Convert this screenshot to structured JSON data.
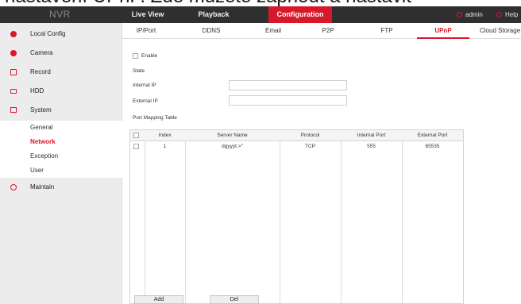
{
  "caption": {
    "text": "nastavení UPnP. Zde můžete zapnout a nastavit"
  },
  "topbar": {
    "brand": "NVR",
    "tabs": [
      {
        "label": "Live View"
      },
      {
        "label": "Playback"
      },
      {
        "label": "Configuration",
        "active": true
      }
    ],
    "user_label": "admin",
    "help_label": "Help",
    "accent_color": "#d7182a"
  },
  "sidebar": {
    "items": [
      {
        "label": "Local Config",
        "icon": "gear-icon"
      },
      {
        "label": "Camera",
        "icon": "camera-icon"
      },
      {
        "label": "Record",
        "icon": "record-icon"
      },
      {
        "label": "HDD",
        "icon": "hdd-icon"
      },
      {
        "label": "System",
        "icon": "monitor-icon",
        "expanded": true
      },
      {
        "label": "Maintain",
        "icon": "info-icon"
      }
    ],
    "system_subitems": [
      {
        "label": "General"
      },
      {
        "label": "Network",
        "active": true
      },
      {
        "label": "Exception"
      },
      {
        "label": "User"
      }
    ]
  },
  "subtabs": [
    {
      "label": "IP/Port"
    },
    {
      "label": "DDNS"
    },
    {
      "label": "Email"
    },
    {
      "label": "P2P"
    },
    {
      "label": "FTP"
    },
    {
      "label": "UPnP",
      "active": true
    },
    {
      "label": "Cloud Storage"
    }
  ],
  "upnp": {
    "enable_label": "Enable",
    "enabled": false,
    "state_label": "State",
    "internal_ip_label": "Internal IP",
    "internal_ip_value": "",
    "external_ip_label": "External IP",
    "external_ip_value": "",
    "table_title": "Port Mapping Table",
    "columns": [
      "Index",
      "Server Name",
      "Protocol",
      "Internal Port",
      "External Port"
    ],
    "rows": [
      {
        "index": "1",
        "server_name": "dgyyyt.>\"",
        "protocol": "TCP",
        "internal_port": "555",
        "external_port": "65535"
      }
    ],
    "add_label": "Add",
    "del_label": "Del"
  }
}
